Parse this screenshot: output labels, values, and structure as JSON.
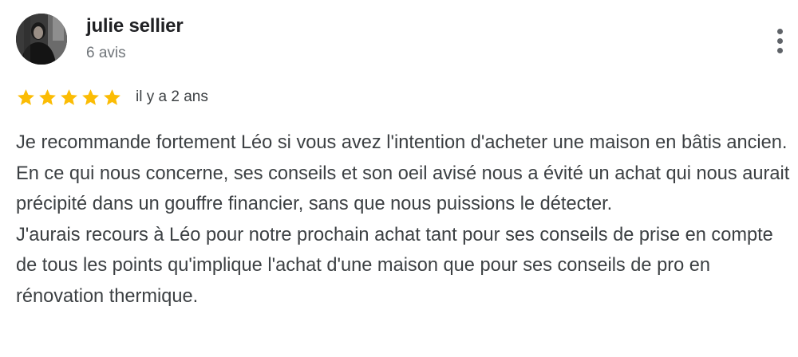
{
  "reviewer": {
    "name": "julie sellier",
    "review_count": "6 avis"
  },
  "rating": {
    "stars": 5,
    "max": 5,
    "color": "#fbbc04",
    "time_ago": "il y a 2 ans"
  },
  "review": {
    "paragraph_1": "Je recommande fortement Léo si vous avez l'intention d'acheter une maison en bâtis ancien. En ce qui nous concerne, ses conseils et son oeil avisé nous a évité un achat qui nous aurait précipité dans un gouffre financier, sans que nous puissions le détecter.",
    "paragraph_2": "J'aurais recours à Léo pour notre prochain achat tant pour ses conseils de prise en compte de tous les points qu'implique l'achat d'une maison que pour ses conseils de pro en rénovation thermique."
  },
  "icons": {
    "menu": "more-vert-icon",
    "star": "star-icon"
  }
}
